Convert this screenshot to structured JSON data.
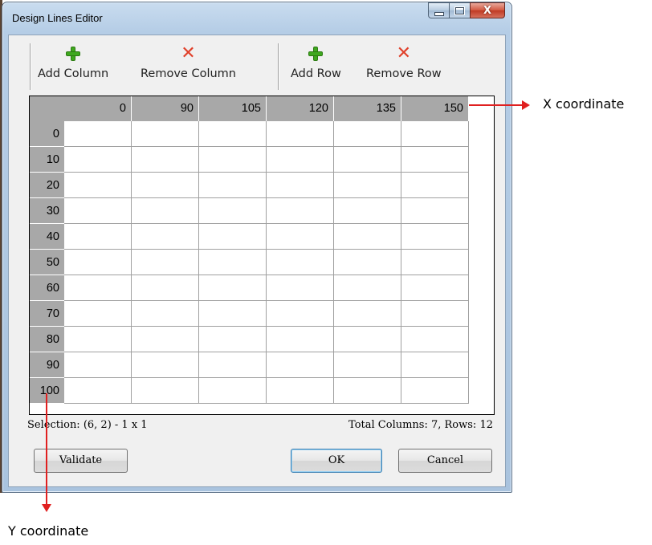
{
  "window": {
    "title": "Design Lines Editor",
    "close_glyph": "X",
    "icons": {
      "minimize": "minimize-icon",
      "maximize": "maximize-icon",
      "close": "close-icon"
    }
  },
  "toolbar": {
    "add_column": {
      "label": "Add Column",
      "icon": "plus-icon"
    },
    "remove_column": {
      "label": "Remove Column",
      "icon": "x-icon"
    },
    "add_row": {
      "label": "Add Row",
      "icon": "plus-icon"
    },
    "remove_row": {
      "label": "Remove Row",
      "icon": "x-icon"
    }
  },
  "grid": {
    "column_headers": [
      "0",
      "90",
      "105",
      "120",
      "135",
      "150"
    ],
    "row_headers": [
      "0",
      "10",
      "20",
      "30",
      "40",
      "50",
      "60",
      "70",
      "80",
      "90",
      "100"
    ]
  },
  "status": {
    "selection": "Selection: (6, 2) - 1 x 1",
    "totals": "Total Columns: 7, Rows: 12"
  },
  "buttons": {
    "validate": "Validate",
    "ok": "OK",
    "cancel": "Cancel"
  },
  "annotations": {
    "x_label": "X coordinate",
    "y_label": "Y coordinate",
    "color": "#e02020"
  }
}
